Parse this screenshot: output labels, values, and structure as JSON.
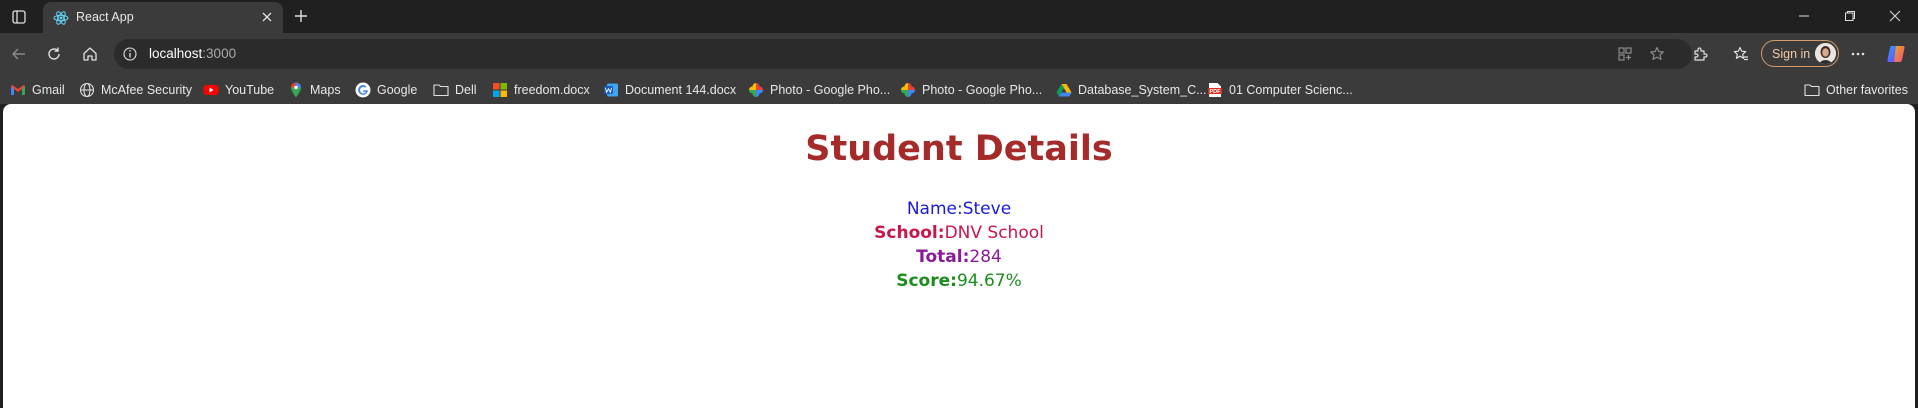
{
  "tab": {
    "title": "React App"
  },
  "address": {
    "host": "localhost",
    "port": ":3000"
  },
  "toolbar": {
    "signin_label": "Sign in"
  },
  "favorites": [
    {
      "label": "Gmail",
      "icon": "gmail-icon"
    },
    {
      "label": "McAfee Security",
      "icon": "globe-icon"
    },
    {
      "label": "YouTube",
      "icon": "youtube-icon"
    },
    {
      "label": "Maps",
      "icon": "maps-icon"
    },
    {
      "label": "Google",
      "icon": "google-icon"
    },
    {
      "label": "Dell",
      "icon": "folder-icon"
    },
    {
      "label": "freedom.docx",
      "icon": "microsoft-icon"
    },
    {
      "label": "Document 144.docx",
      "icon": "word-icon"
    },
    {
      "label": "Photo - Google Pho...",
      "icon": "google-photos-icon"
    },
    {
      "label": "Photo - Google Pho...",
      "icon": "google-photos-icon"
    },
    {
      "label": "Database_System_C...",
      "icon": "google-drive-icon"
    },
    {
      "label": "01 Computer Scienc...",
      "icon": "pdf-icon"
    }
  ],
  "other_favorites": "Other favorites",
  "page": {
    "title": "Student Details",
    "name_label": "Name:",
    "name_value": "Steve",
    "school_label": "School:",
    "school_value": "DNV School",
    "total_label": "Total:",
    "total_value": "284",
    "score_label": "Score:",
    "score_value": "94.67%"
  },
  "colors": {
    "title": "#a52a2a",
    "name": "#1a1adc",
    "school": "#c8174a",
    "total": "#8a1a9a",
    "score": "#1c8c1c"
  }
}
